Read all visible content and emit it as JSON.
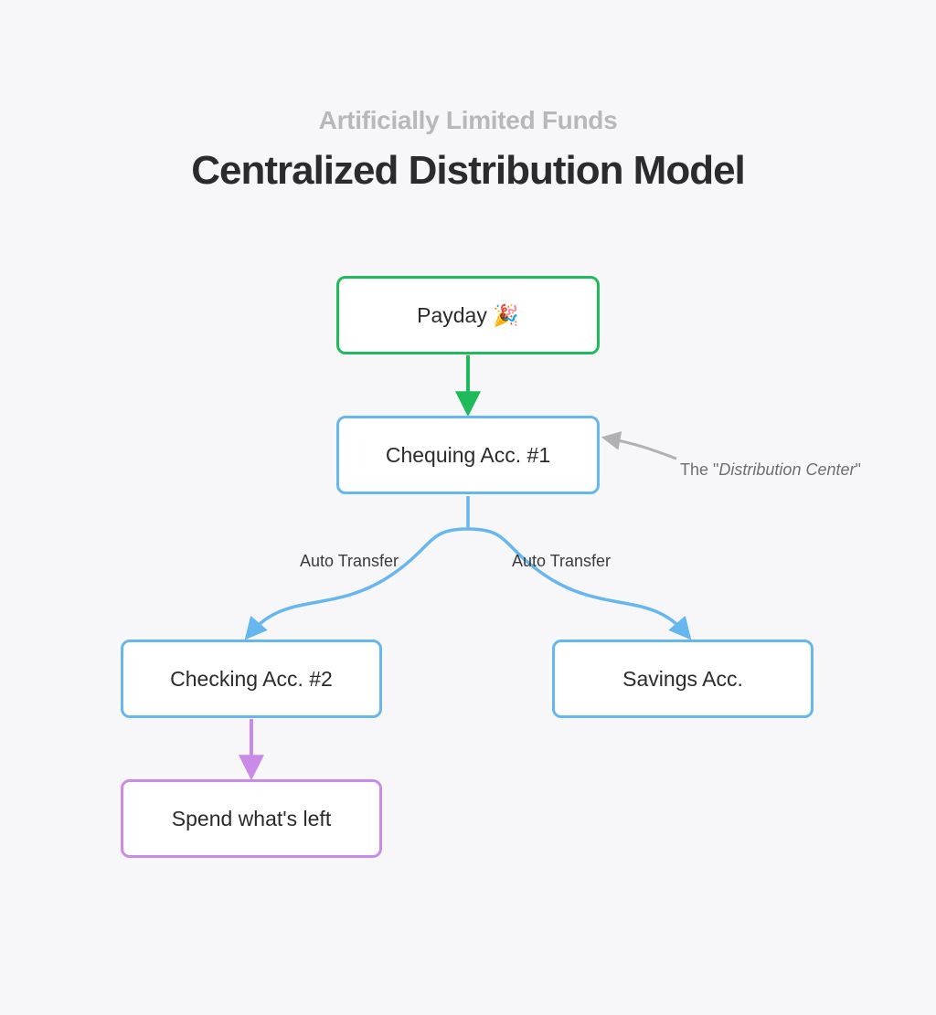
{
  "header": {
    "subtitle": "Artificially Limited Funds",
    "title": "Centralized Distribution Model"
  },
  "nodes": {
    "payday": "Payday 🎉",
    "chequing1": "Chequing Acc. #1",
    "checking2": "Checking Acc. #2",
    "savings": "Savings Acc.",
    "spend": "Spend what's left"
  },
  "edges": {
    "auto_transfer_left": "Auto Transfer",
    "auto_transfer_right": "Auto Transfer"
  },
  "annotation": {
    "prefix": "The \"",
    "italic": "Distribution Center",
    "suffix": "\""
  },
  "colors": {
    "green": "#1fba5a",
    "blue": "#66b6ef",
    "purple": "#c98ae8",
    "grey_arrow": "#b1b1b4",
    "bg": "#f7f7f9"
  }
}
